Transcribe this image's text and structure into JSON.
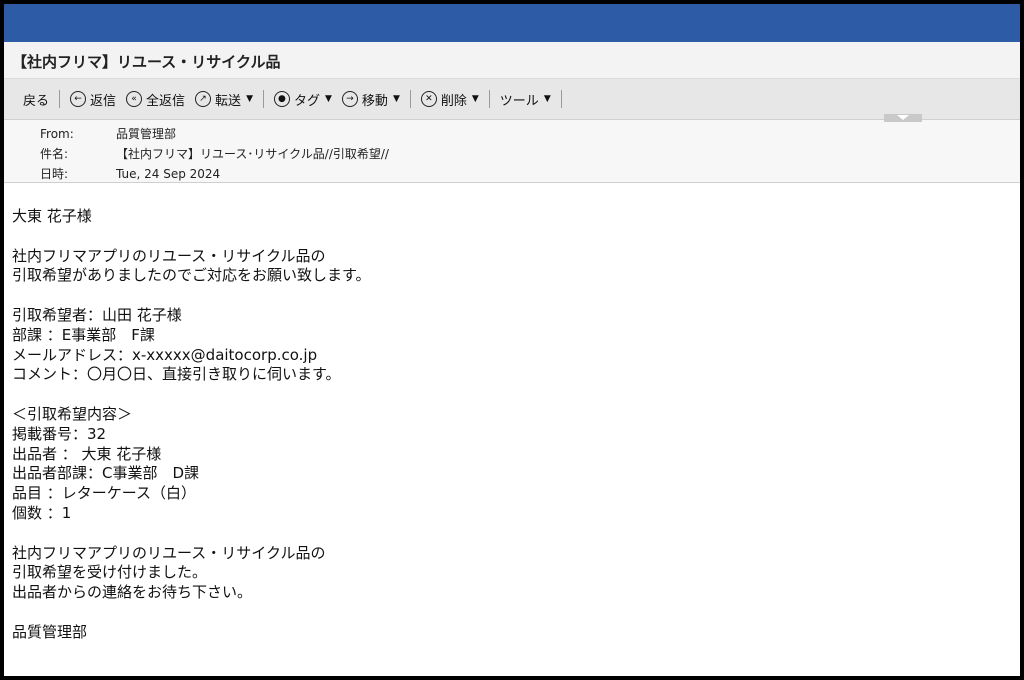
{
  "subject_title": "【社内フリマ】リユース・リサイクル品",
  "toolbar": {
    "back": "戻る",
    "reply": "返信",
    "reply_all": "全返信",
    "forward": "転送",
    "tag": "タグ",
    "move": "移動",
    "delete": "削除",
    "tools": "ツール"
  },
  "header": {
    "from_label": "From:",
    "from_value": "品質管理部",
    "subject_label": "件名:",
    "subject_value": "【社内フリマ】リユース･リサイクル品//引取希望//",
    "date_label": "日時:",
    "date_value": "Tue, 24 Sep 2024"
  },
  "body": {
    "greeting": "大東 花子様",
    "intro": [
      "社内フリマアプリのリユース・リサイクル品の",
      "引取希望がありましたのでご対応をお願い致します。"
    ],
    "requester": [
      "引取希望者：山田 花子様",
      "部課 ：E事業部　F課",
      "メールアドレス：x-xxxxx@daitocorp.co.jp",
      "コメント：〇月〇日、直接引き取りに伺います。"
    ],
    "item": [
      "＜引取希望内容＞",
      "掲載番号：32",
      "出品者 ： 大東 花子様",
      "出品者部課：C事業部　D課",
      "品目 ：レターケース（白）",
      "個数 ：1"
    ],
    "closing": [
      "社内フリマアプリのリユース・リサイクル品の",
      "引取希望を受け付けました。",
      "出品者からの連絡をお待ち下さい。"
    ],
    "signature": "品質管理部"
  }
}
